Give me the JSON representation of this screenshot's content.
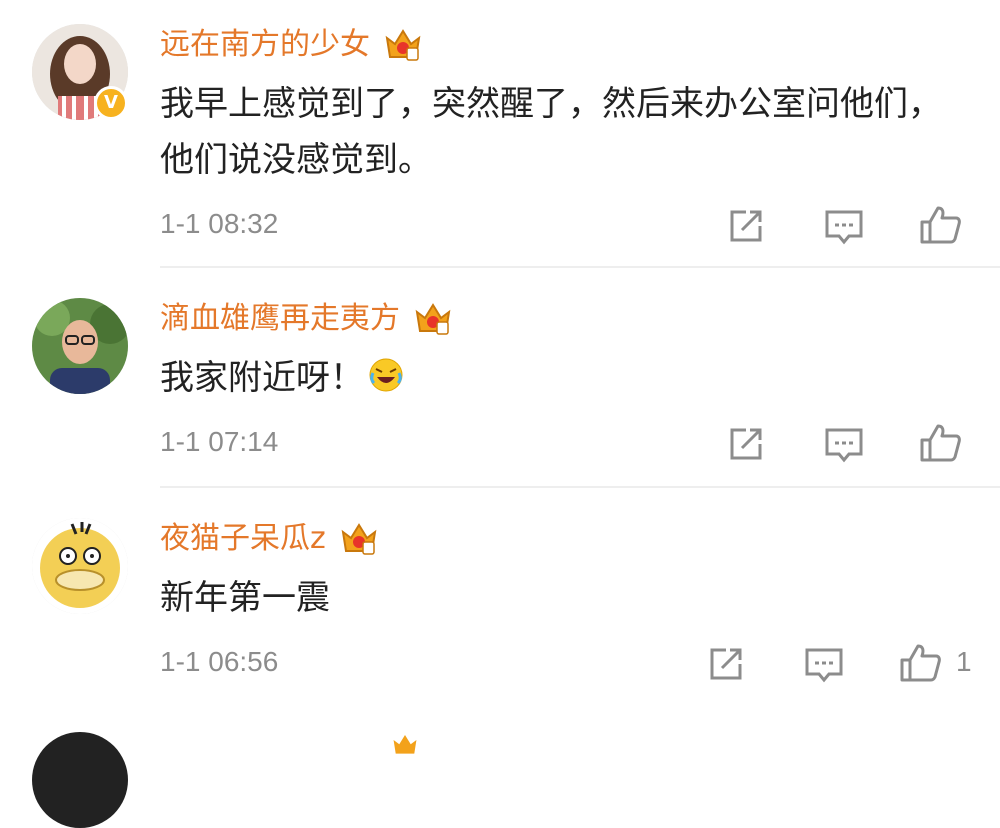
{
  "comments": [
    {
      "username": "远在南方的少女",
      "verified_badge": "V",
      "text": "我早上感觉到了，突然醒了，然后来办公室问他们，他们说没感觉到。",
      "time": "1-1 08:32",
      "like_count": ""
    },
    {
      "username": "滴血雄鹰再走夷方",
      "text": "我家附近呀！",
      "emoji": "laughing-crying-emoji",
      "time": "1-1 07:14",
      "like_count": ""
    },
    {
      "username": "夜猫子呆瓜z",
      "text": "新年第一震",
      "time": "1-1 06:56",
      "like_count": "1"
    }
  ],
  "icons": {
    "share": "share-icon",
    "comment": "comment-icon",
    "like": "like-icon",
    "crown": "vip-crown-icon"
  },
  "colors": {
    "username": "#e4782a",
    "meta": "#8c8c8c",
    "text": "#222222",
    "badge": "#f7b21f"
  }
}
